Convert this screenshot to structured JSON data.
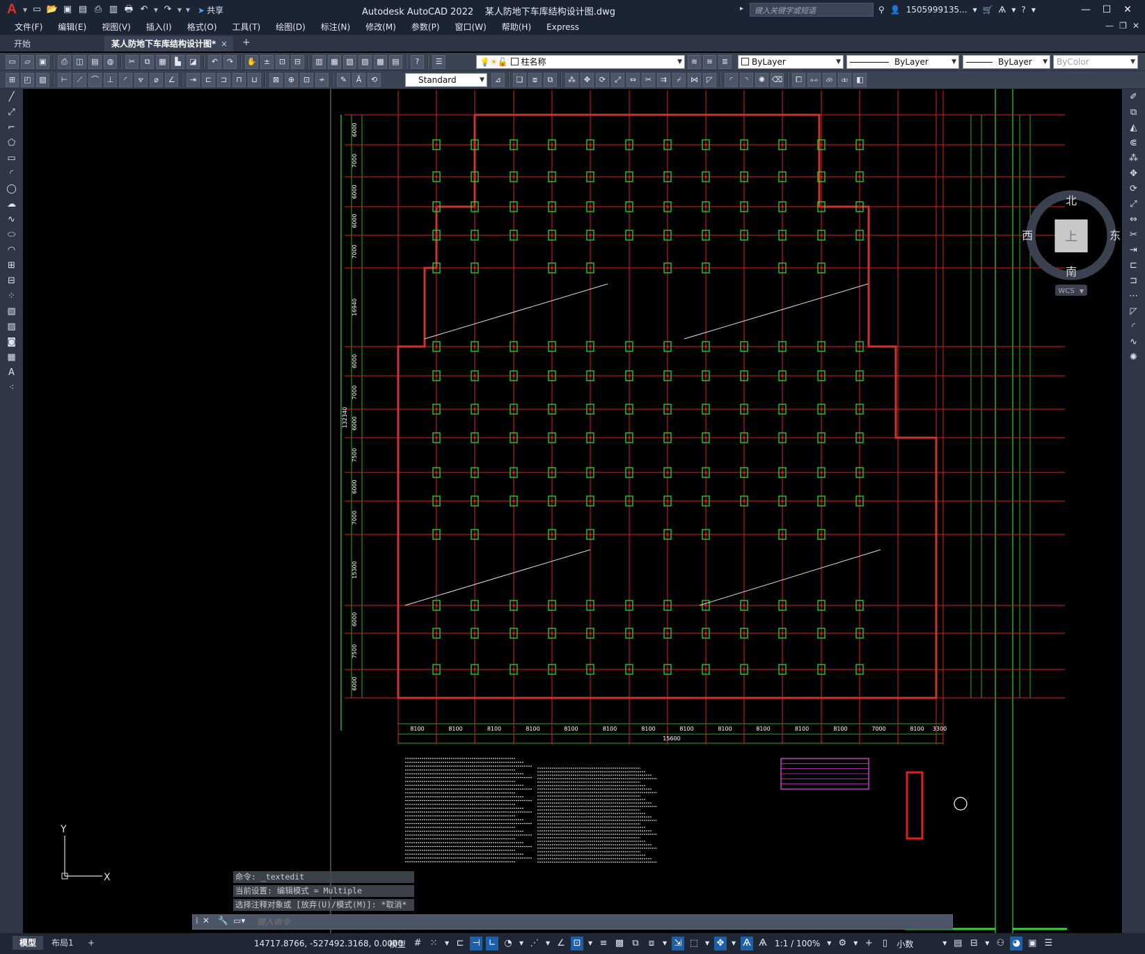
{
  "titlebar": {
    "app_logo": "A",
    "share_label": "共享",
    "title": "Autodesk AutoCAD 2022    某人防地下车库结构设计图.dwg",
    "search_placeholder": "键入关键字或短语",
    "user": "1505999135...",
    "icons": [
      "new-icon",
      "open-icon",
      "save-icon",
      "save-as-icon",
      "publish-icon",
      "plot-icon",
      "undo-icon",
      "redo-icon",
      "share-icon",
      "search-icon",
      "user-icon",
      "cart-icon",
      "autodesk-app-icon",
      "help-icon",
      "minimize-icon",
      "maximize-icon",
      "close-icon"
    ]
  },
  "menubar": {
    "items": [
      "文件(F)",
      "编辑(E)",
      "视图(V)",
      "插入(I)",
      "格式(O)",
      "工具(T)",
      "绘图(D)",
      "标注(N)",
      "修改(M)",
      "参数(P)",
      "窗口(W)",
      "帮助(H)",
      "Express"
    ]
  },
  "tabs": {
    "start": "开始",
    "active": "某人防地下车库结构设计图*",
    "close": "×",
    "add": "+"
  },
  "toolbar": {
    "layer_name": "柱名称",
    "color": "ByLayer",
    "linetype": "ByLayer",
    "lineweight": "ByLayer",
    "plotstyle": "ByColor",
    "text_style": "Standard"
  },
  "drawing": {
    "layers": {
      "grid": "#e51d1d",
      "column": "#22dd22",
      "wall": "#cc3333",
      "frame": "#2fdb2f",
      "text": "#ffffff"
    },
    "bottom_dimensions": [
      "8100",
      "8100",
      "8100",
      "8100",
      "8100",
      "8100",
      "8100",
      "8100",
      "8100",
      "8100",
      "8100",
      "8100",
      "7000",
      "8100",
      "3300"
    ],
    "bottom_total": "15600",
    "left_dimensions": [
      "6000",
      "7000",
      "6000",
      "6000",
      "7000",
      "16940",
      "6000",
      "7000",
      "6000",
      "7500",
      "6000",
      "7000",
      "15300",
      "6000",
      "7500",
      "6000"
    ],
    "left_total": "132340"
  },
  "viewcube": {
    "north": "北",
    "south": "南",
    "east": "东",
    "west": "西",
    "face": "上",
    "wcs": "WCS"
  },
  "ucs": {
    "y": "Y",
    "x": "X"
  },
  "command": {
    "history": [
      "命令: _textedit",
      "当前设置: 编辑模式 = Multiple",
      "选择注释对象或 [放弃(U)/模式(M)]: *取消*"
    ],
    "placeholder": "键入命令"
  },
  "status": {
    "layouts": [
      "模型",
      "布局1",
      "+"
    ],
    "coordinates": "14717.8766, -527492.3168, 0.0000",
    "model_label": "模型",
    "scale": "1:1 / 100%",
    "units": "小数"
  }
}
